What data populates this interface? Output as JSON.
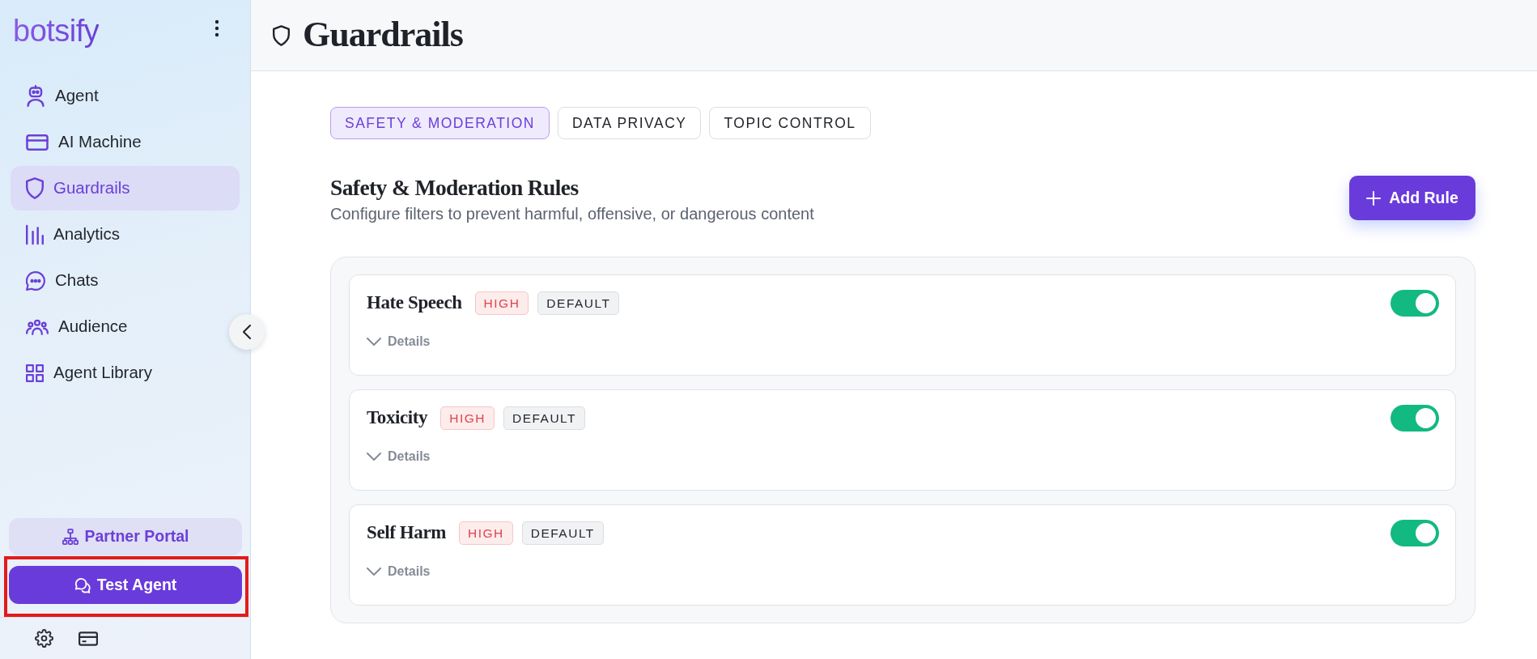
{
  "sidebar": {
    "logo": "botsify",
    "nav": [
      {
        "label": "Agent",
        "selected": false
      },
      {
        "label": "AI Machine",
        "selected": false
      },
      {
        "label": "Guardrails",
        "selected": true
      },
      {
        "label": "Analytics",
        "selected": false
      },
      {
        "label": "Chats",
        "selected": false
      },
      {
        "label": "Audience",
        "selected": false
      },
      {
        "label": "Agent Library",
        "selected": false
      }
    ],
    "partner_portal": "Partner Portal",
    "test_agent": {
      "label": "Test Agent",
      "highlighted": true
    }
  },
  "header": {
    "title": "Guardrails"
  },
  "tabs": [
    {
      "label": "SAFETY & MODERATION",
      "selected": true
    },
    {
      "label": "DATA PRIVACY",
      "selected": false
    },
    {
      "label": "TOPIC CONTROL",
      "selected": false
    }
  ],
  "section": {
    "title": "Safety & Moderation Rules",
    "subtitle": "Configure filters to prevent harmful, offensive, or dangerous content",
    "add_button": "Add Rule"
  },
  "rules": [
    {
      "name": "Hate Speech",
      "badges": [
        {
          "label": "HIGH",
          "kind": "severity"
        },
        {
          "label": "DEFAULT",
          "kind": "tag"
        }
      ],
      "details": "Details",
      "expanded": false,
      "on": true
    },
    {
      "name": "Toxicity",
      "badges": [
        {
          "label": "HIGH",
          "kind": "severity"
        },
        {
          "label": "DEFAULT",
          "kind": "tag"
        }
      ],
      "details": "Details",
      "expanded": false,
      "on": true
    },
    {
      "name": "Self Harm",
      "badges": [
        {
          "label": "HIGH",
          "kind": "severity"
        },
        {
          "label": "DEFAULT",
          "kind": "tag"
        }
      ],
      "details": "Details",
      "expanded": false,
      "on": true
    }
  ]
}
